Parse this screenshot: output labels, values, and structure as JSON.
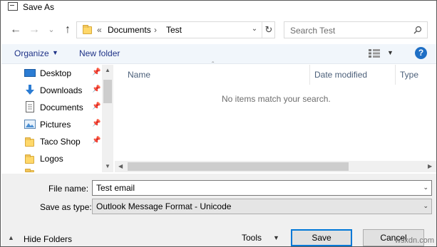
{
  "window": {
    "title": "Save As"
  },
  "nav": {
    "back": "←",
    "forward": "→",
    "recent": "⌄",
    "up": "↑"
  },
  "address": {
    "prefix": "«",
    "path": [
      "Documents",
      "Test"
    ],
    "separator": "›"
  },
  "search": {
    "placeholder": "Search Test"
  },
  "toolbar": {
    "organize_label": "Organize",
    "new_folder_label": "New folder",
    "help_label": "?"
  },
  "sidebar": {
    "items": [
      {
        "label": "Desktop",
        "icon": "desktop-icon",
        "pinned": true
      },
      {
        "label": "Downloads",
        "icon": "download-icon",
        "pinned": true
      },
      {
        "label": "Documents",
        "icon": "document-icon",
        "pinned": true
      },
      {
        "label": "Pictures",
        "icon": "pictures-icon",
        "pinned": true
      },
      {
        "label": "Taco Shop",
        "icon": "folder-icon",
        "pinned": true
      },
      {
        "label": "Logos",
        "icon": "folder-icon",
        "pinned": false
      }
    ]
  },
  "file_list": {
    "columns": [
      "Name",
      "Date modified",
      "Type"
    ],
    "empty_message": "No items match your search."
  },
  "form": {
    "file_name_label": "File name:",
    "file_name_value": "Test email",
    "save_type_label": "Save as type:",
    "save_type_value": "Outlook Message Format - Unicode"
  },
  "footer": {
    "hide_folders_label": "Hide Folders",
    "tools_label": "Tools",
    "save_label": "Save",
    "cancel_label": "Cancel"
  },
  "colors": {
    "link_blue": "#1e3287",
    "help_blue": "#1f6fc5",
    "toolbar_bg": "#f1f6fb",
    "primary_border": "#0078d7"
  },
  "watermark": "wsxdn.com"
}
